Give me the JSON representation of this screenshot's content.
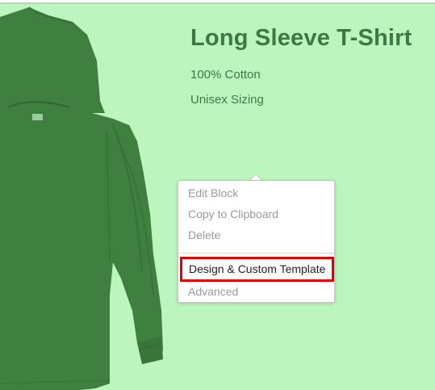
{
  "product": {
    "title": "Long Sleeve T-Shirt",
    "features": [
      "100% Cotton",
      "Unisex Sizing"
    ],
    "image_icon": "long-sleeve-shirt-illustration",
    "shirt_color": "#3f7f40",
    "background_color": "#bcf5bd"
  },
  "context_menu": {
    "items": [
      {
        "label": "Edit Block"
      },
      {
        "label": "Copy to Clipboard"
      },
      {
        "label": "Delete"
      },
      {
        "label": "Design & Custom Template",
        "highlighted": true
      },
      {
        "label": "Advanced"
      }
    ],
    "highlight_color": "#e00000"
  }
}
